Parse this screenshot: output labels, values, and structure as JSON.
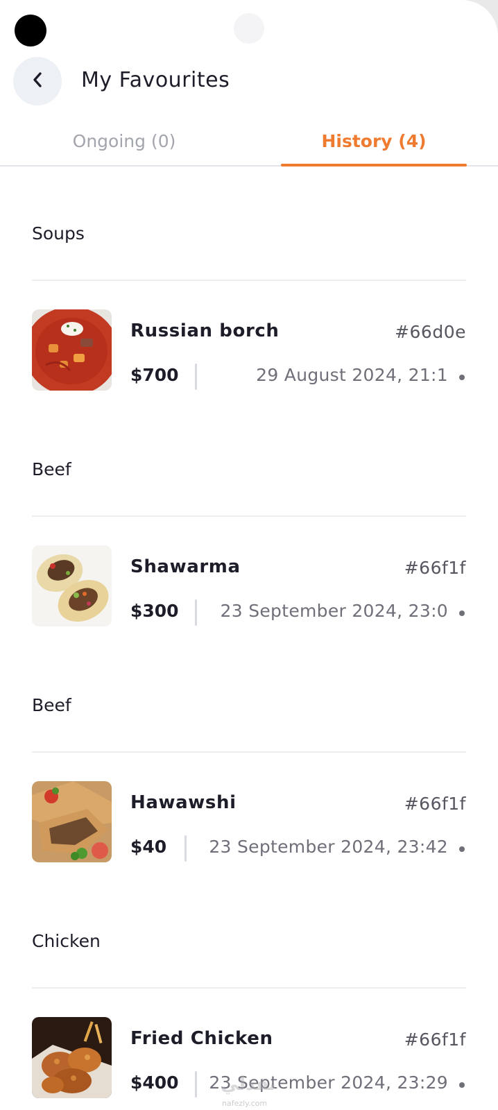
{
  "header": {
    "title": "My Favourites",
    "back_icon": "chevron-left-icon"
  },
  "tabs": [
    {
      "label": "Ongoing (0)",
      "active": false
    },
    {
      "label": "History (4)",
      "active": true
    }
  ],
  "accent_color": "#ee7b30",
  "orders": [
    {
      "category": "Soups",
      "name": "Russian borch",
      "order_id": "#66d0e",
      "price": "$700",
      "date": "29 August 2024, 21:1"
    },
    {
      "category": "Beef",
      "name": "Shawarma",
      "order_id": "#66f1f",
      "price": "$300",
      "date": "23 September 2024, 23:0"
    },
    {
      "category": "Beef",
      "name": "Hawawshi",
      "order_id": "#66f1f",
      "price": "$40",
      "date": "23 September 2024, 23:42"
    },
    {
      "category": "Chicken",
      "name": "Fried Chicken",
      "order_id": "#66f1f",
      "price": "$400",
      "date": "23 September 2024, 23:29"
    }
  ],
  "watermark": {
    "text": "نفذلي",
    "sub": "nafezly.com"
  }
}
